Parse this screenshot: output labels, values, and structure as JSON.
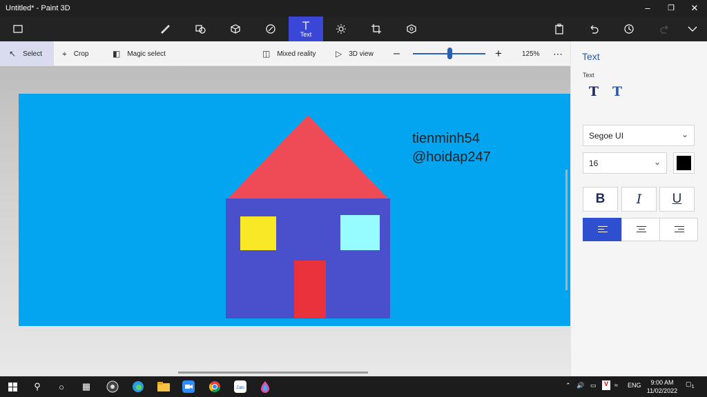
{
  "window": {
    "title": "Untitled* - Paint 3D"
  },
  "ribbon": {
    "active_tool_label": "Text"
  },
  "toolbar": {
    "select_label": "Select",
    "crop_label": "Crop",
    "magic_select_label": "Magic select",
    "mixed_reality_label": "Mixed reality",
    "view3d_label": "3D view",
    "zoom_level": "125%"
  },
  "canvas": {
    "text_line1": "tienminh54",
    "text_line2": "@hoidap247",
    "background_color": "#04a5f0"
  },
  "panel": {
    "title": "Text",
    "section_label": "Text",
    "font_name": "Segoe UI",
    "font_size": "16",
    "bold_label": "B",
    "italic_label": "I",
    "underline_label": "U",
    "text_color": "#000000"
  },
  "taskbar": {
    "language": "ENG",
    "time": "9:00 AM",
    "date": "11/02/2022",
    "notification_count": "1"
  },
  "colors": {
    "accent": "#3a46d6",
    "panel_accent": "#2f4fd1"
  }
}
